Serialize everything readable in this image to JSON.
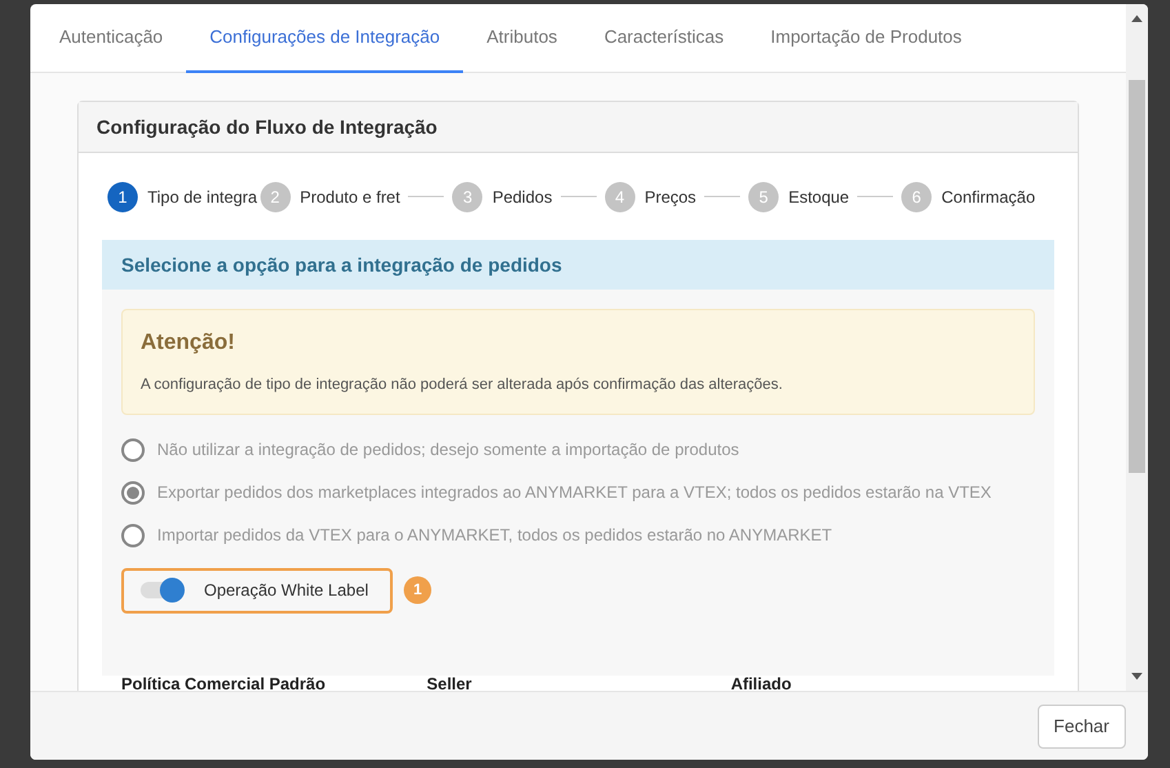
{
  "tabs": [
    {
      "label": "Autenticação",
      "selected": false
    },
    {
      "label": "Configurações de Integração",
      "selected": true
    },
    {
      "label": "Atributos",
      "selected": false
    },
    {
      "label": "Características",
      "selected": false
    },
    {
      "label": "Importação de Produtos",
      "selected": false
    }
  ],
  "card": {
    "title": "Configuração do Fluxo de Integração",
    "steps": [
      {
        "number": "1",
        "label": "Tipo de integra",
        "selected": true
      },
      {
        "number": "2",
        "label": "Produto e fret",
        "selected": false
      },
      {
        "number": "3",
        "label": "Pedidos",
        "selected": false
      },
      {
        "number": "4",
        "label": "Preços",
        "selected": false
      },
      {
        "number": "5",
        "label": "Estoque",
        "selected": false
      },
      {
        "number": "6",
        "label": "Confirmação",
        "selected": false
      }
    ],
    "section_title": "Selecione a opção para a integração de pedidos",
    "alert": {
      "title": "Atenção!",
      "text": "A configuração de tipo de integração não poderá ser alterada após confirmação das alterações."
    },
    "options": [
      {
        "label": "Não utilizar a integração de pedidos; desejo somente a importação de produtos",
        "selected": false
      },
      {
        "label": "Exportar pedidos dos marketplaces integrados ao ANYMARKET para a VTEX; todos os pedidos estarão na VTEX",
        "selected": true
      },
      {
        "label": "Importar pedidos da VTEX para o ANYMARKET, todos os pedidos estarão no ANYMARKET",
        "selected": false
      }
    ],
    "toggle": {
      "label": "Operação White Label",
      "on": true,
      "callout": "1"
    },
    "columns": [
      "Política Comercial Padrão",
      "Seller",
      "Afiliado"
    ]
  },
  "footer": {
    "close_button": "Fechar"
  }
}
